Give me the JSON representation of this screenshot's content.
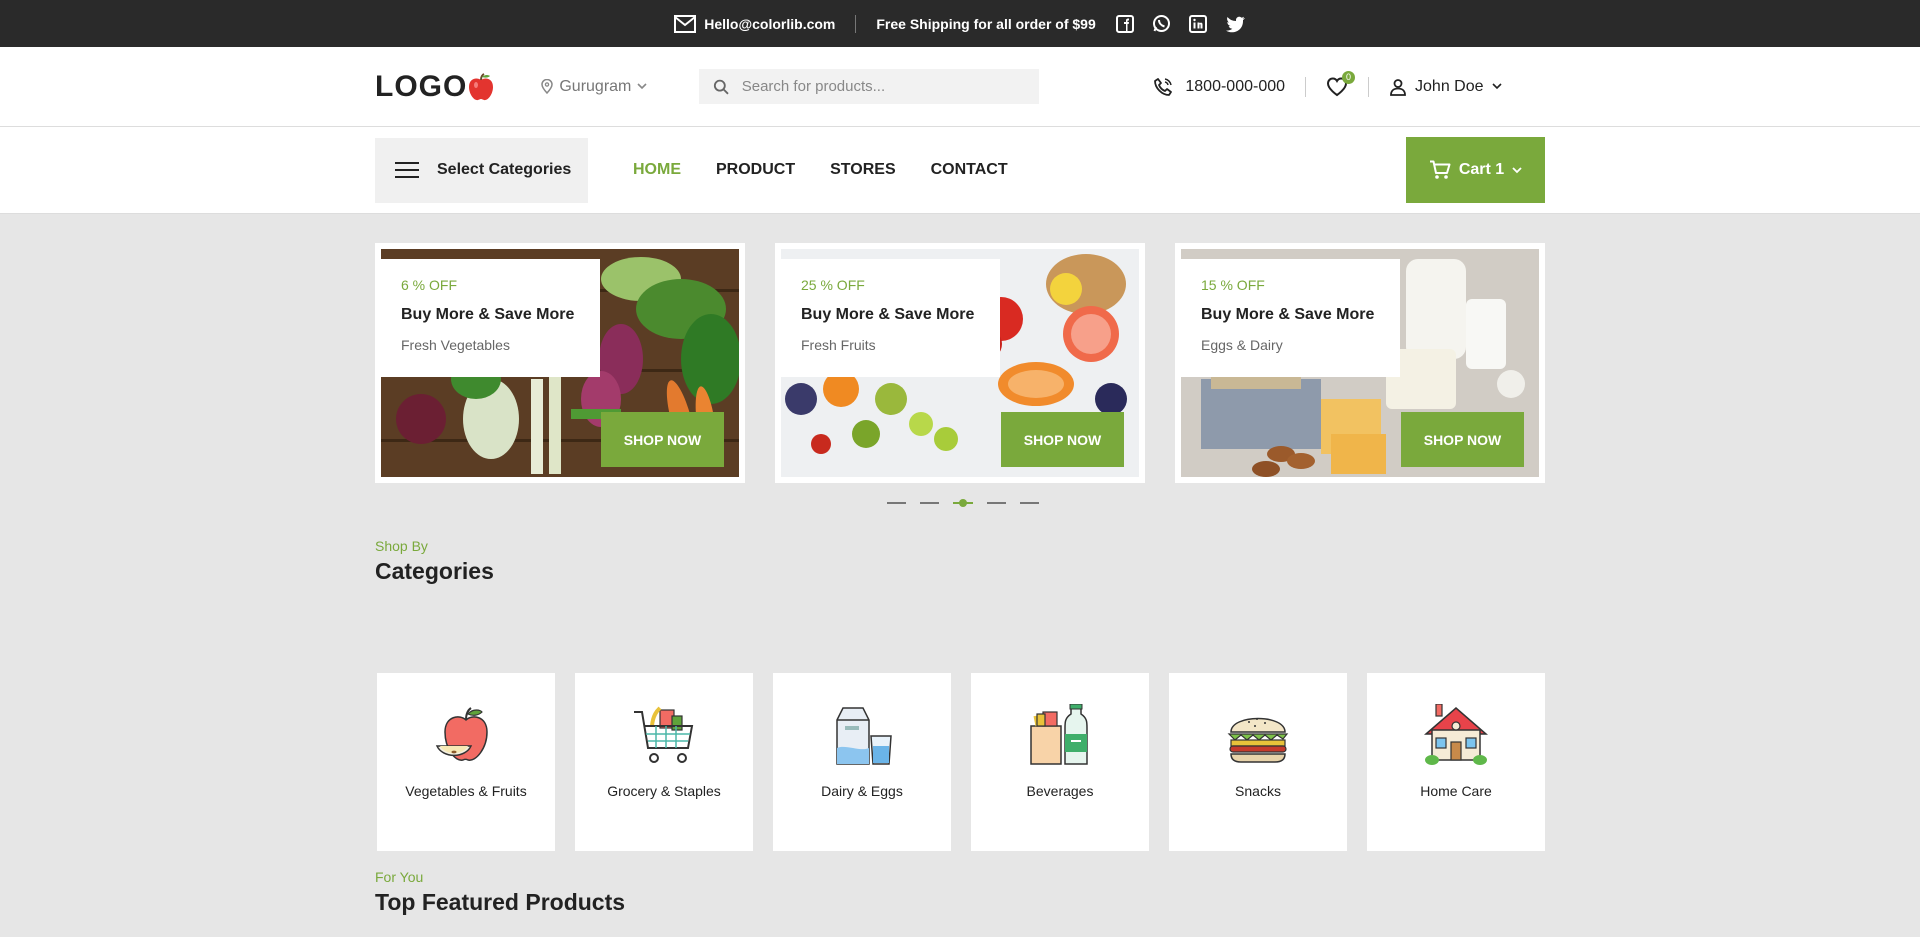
{
  "topbar": {
    "email": "Hello@colorlib.com",
    "shipping": "Free Shipping for all order of $99",
    "social": [
      "facebook-icon",
      "whatsapp-icon",
      "linkedin-icon",
      "twitter-icon"
    ]
  },
  "header": {
    "logo": "LOGO",
    "location": "Gurugram",
    "search_placeholder": "Search for products...",
    "phone": "1800-000-000",
    "wishlist_count": "0",
    "user_name": "John Doe"
  },
  "nav": {
    "categories_label": "Select Categories",
    "items": [
      "HOME",
      "PRODUCT",
      "STORES",
      "CONTACT"
    ],
    "active_item": "HOME",
    "cart_label": "Cart 1"
  },
  "banners": [
    {
      "off": "6 % OFF",
      "title": "Buy More & Save More",
      "sub": "Fresh Vegetables",
      "cta": "SHOP NOW"
    },
    {
      "off": "25 % OFF",
      "title": "Buy More & Save More",
      "sub": "Fresh Fruits",
      "cta": "SHOP NOW"
    },
    {
      "off": "15 % OFF",
      "title": "Buy More & Save More",
      "sub": "Eggs & Dairy",
      "cta": "SHOP NOW"
    }
  ],
  "slider": {
    "dot_count": 5,
    "active_dot": 3
  },
  "shop_by": {
    "sub": "Shop By",
    "title": "Categories"
  },
  "categories": [
    {
      "label": "Vegetables & Fruits",
      "icon": "apple-icon"
    },
    {
      "label": "Grocery & Staples",
      "icon": "shopping-cart-icon"
    },
    {
      "label": "Dairy & Eggs",
      "icon": "milk-icon"
    },
    {
      "label": "Beverages",
      "icon": "bottle-icon"
    },
    {
      "label": "Snacks",
      "icon": "burger-icon"
    },
    {
      "label": "Home Care",
      "icon": "house-icon"
    }
  ],
  "featured": {
    "sub": "For You",
    "title": "Top Featured Products"
  },
  "colors": {
    "accent": "#7aa93c",
    "topbar": "#2a2a2a"
  }
}
